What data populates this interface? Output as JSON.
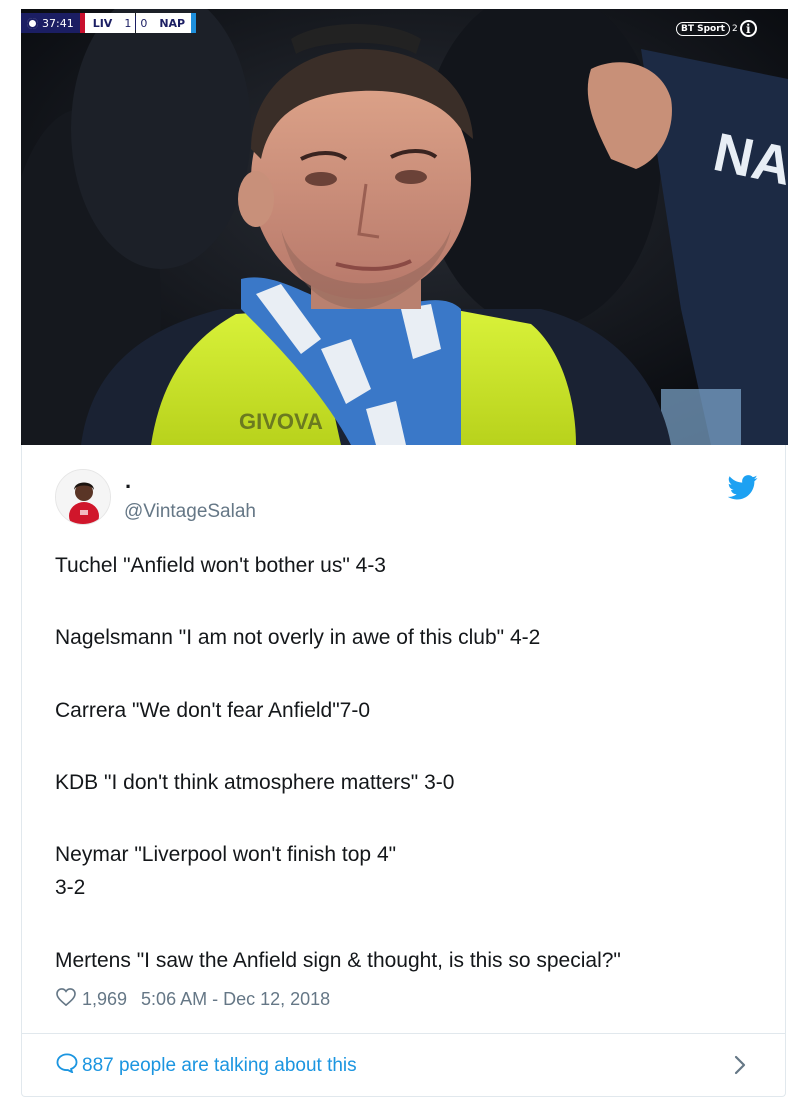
{
  "video_overlay": {
    "match_clock": "37:41",
    "home_team": "LIV",
    "home_score": "1",
    "away_score": "0",
    "away_team": "NAP",
    "channel_logo": "BT Sport",
    "channel_number": "2",
    "info_icon": "info-icon",
    "jacket_brand": "GIVOVA",
    "scarf_text": "NAP"
  },
  "tweet": {
    "display_name": ".",
    "handle": "@VintageSalah",
    "platform_icon": "twitter-bird-icon",
    "lines": [
      "Tuchel \"Anfield won't bother us\" 4-3",
      "Nagelsmann \"I am not overly in awe of this club\" 4-2",
      "Carrera \"We don't fear Anfield\"7-0",
      "KDB \"I don't think atmosphere matters\" 3-0",
      "Neymar \"Liverpool won't finish top 4\"",
      "3-2",
      "Mertens \"I saw the Anfield sign & thought, is this so special?\""
    ],
    "likes": "1,969",
    "timestamp": "5:06 AM - Dec 12, 2018",
    "talking": "887 people are talking about this"
  },
  "colors": {
    "link_blue": "#1b95e0",
    "muted_gray": "#657786",
    "text_dark": "#14171a",
    "hi_vis_yellow": "#d4ef2a",
    "scorebug_navy": "#1b1e63"
  }
}
